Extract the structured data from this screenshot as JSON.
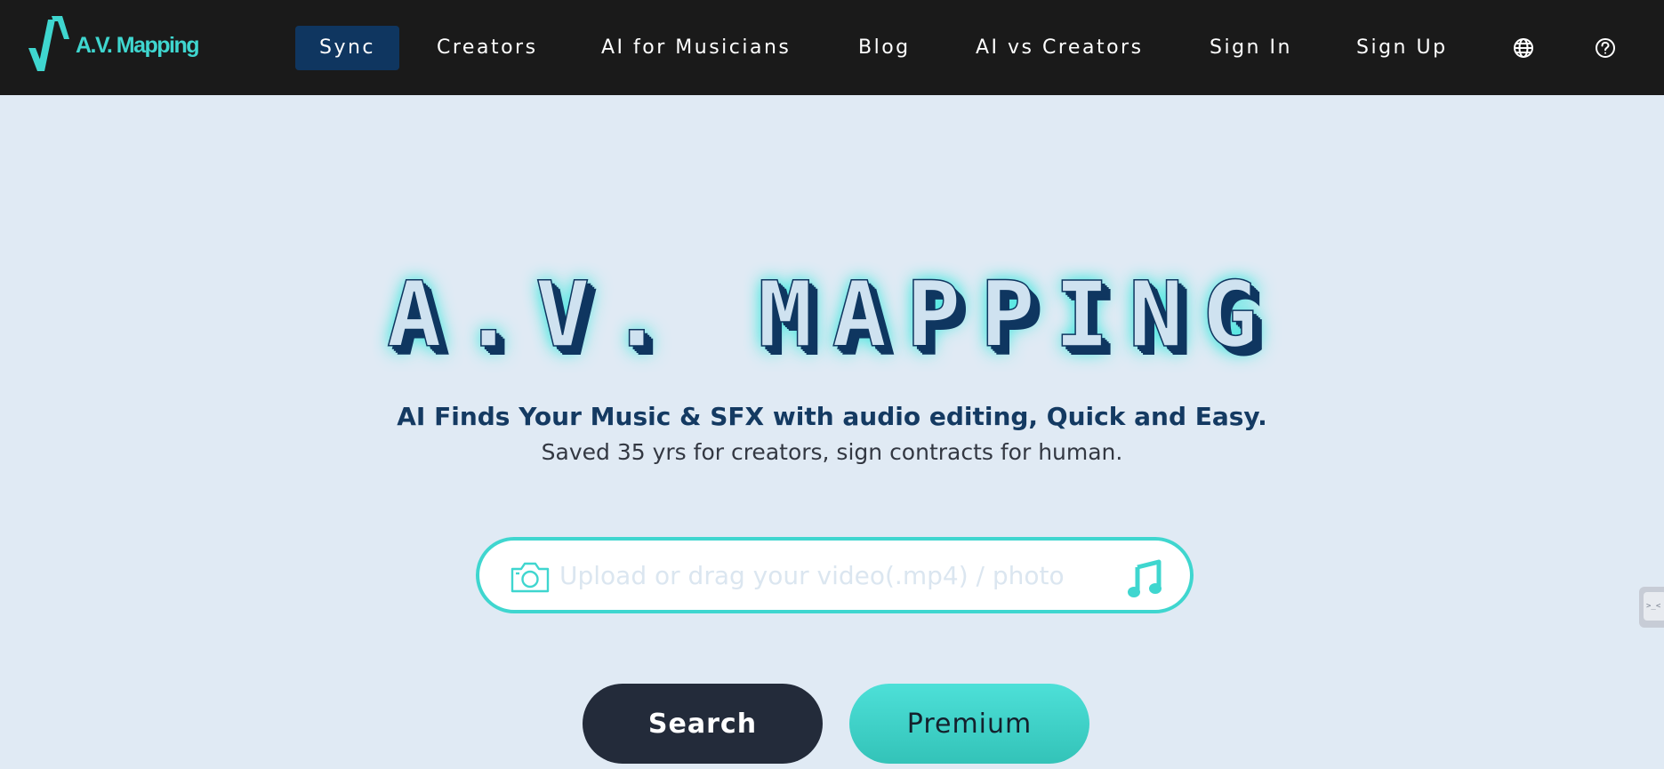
{
  "brand": {
    "logo_text": "A.V. Mapping",
    "accent_color": "#3fd6cf"
  },
  "nav": {
    "items": [
      {
        "label": "Sync",
        "active": true
      },
      {
        "label": "Creators"
      },
      {
        "label": "AI for Musicians"
      },
      {
        "label": "Blog"
      },
      {
        "label": "AI vs Creators"
      },
      {
        "label": "Sign In"
      },
      {
        "label": "Sign Up"
      }
    ],
    "icons": [
      "globe-icon",
      "help-icon"
    ],
    "active_color": "#0f3660",
    "background": "#1a1a1a"
  },
  "hero": {
    "title": "A.V. MAPPING",
    "tagline": "AI Finds Your Music & SFX with audio editing, Quick and Easy.",
    "subline": "Saved 35 yrs for creators, sign contracts for human."
  },
  "upload": {
    "placeholder": "Upload or drag your video(.mp4) / photo",
    "left_icon": "camera-icon",
    "right_icon": "music-note-icon"
  },
  "actions": {
    "search_label": "Search",
    "premium_label": "Premium"
  },
  "side_widget": {
    "label": ">_<"
  },
  "colors": {
    "page_background": "#e0eaf4",
    "search_button": "#232b3a",
    "title_dark": "#0f3660"
  }
}
